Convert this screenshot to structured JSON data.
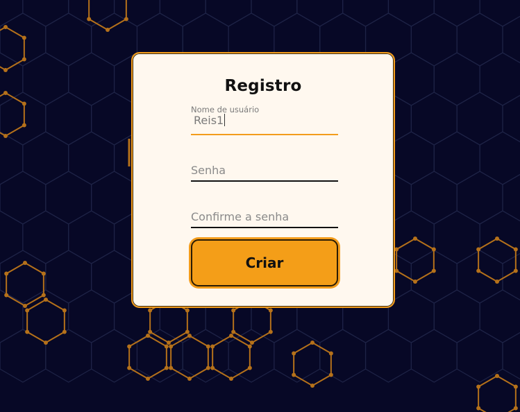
{
  "colors": {
    "background": "#070826",
    "accent": "#f39c1b",
    "card": "#fff8ef"
  },
  "form": {
    "title": "Registro",
    "username_label": "Nome de usuário",
    "username_value": "Reis1",
    "password_placeholder": "Senha",
    "confirm_placeholder": "Confirme a senha",
    "submit_label": "Criar"
  }
}
